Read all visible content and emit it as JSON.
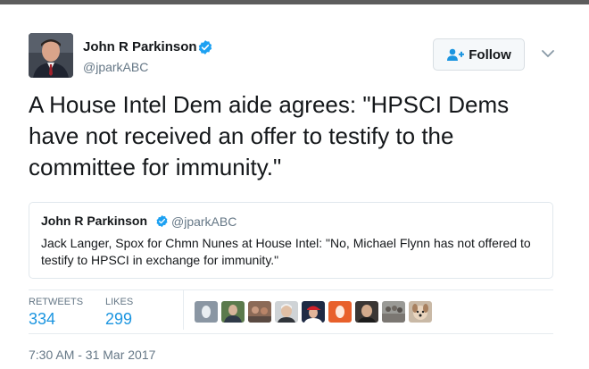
{
  "author": {
    "name": "John R Parkinson",
    "handle": "@jparkABC",
    "avatar_icon": "person-portrait-icon",
    "verified_icon": "verified-badge-icon"
  },
  "follow": {
    "label": "Follow",
    "icon": "add-user-icon"
  },
  "menu": {
    "icon": "chevron-down-icon"
  },
  "tweet": {
    "text": "A House Intel Dem aide agrees: \"HPSCI Dems have not received an offer to testify to the committee for immunity.\""
  },
  "quote": {
    "name": "John R Parkinson",
    "handle": "@jparkABC",
    "text": "Jack Langer, Spox for Chmn Nunes at House Intel: \"No, Michael Flynn has not offered to testify to HPSCI in exchange for immunity.\""
  },
  "stats": {
    "retweets_label": "RETWEETS",
    "retweets_count": "334",
    "likes_label": "LIKES",
    "likes_count": "299"
  },
  "likers": [
    {
      "icon": "default-egg-avatar-icon"
    },
    {
      "icon": "man-photo-avatar-icon"
    },
    {
      "icon": "group-photo-avatar-icon"
    },
    {
      "icon": "man-grey-hair-avatar-icon"
    },
    {
      "icon": "red-cap-avatar-icon"
    },
    {
      "icon": "orange-egg-avatar-icon"
    },
    {
      "icon": "man-dark-avatar-icon"
    },
    {
      "icon": "crowd-photo-avatar-icon"
    },
    {
      "icon": "dog-photo-avatar-icon"
    }
  ],
  "timestamp": "7:30 AM - 31 Mar 2017",
  "colors": {
    "accent": "#1b95e0",
    "verified": "#1da1f2",
    "muted_text": "#657786",
    "text": "#14171a"
  }
}
